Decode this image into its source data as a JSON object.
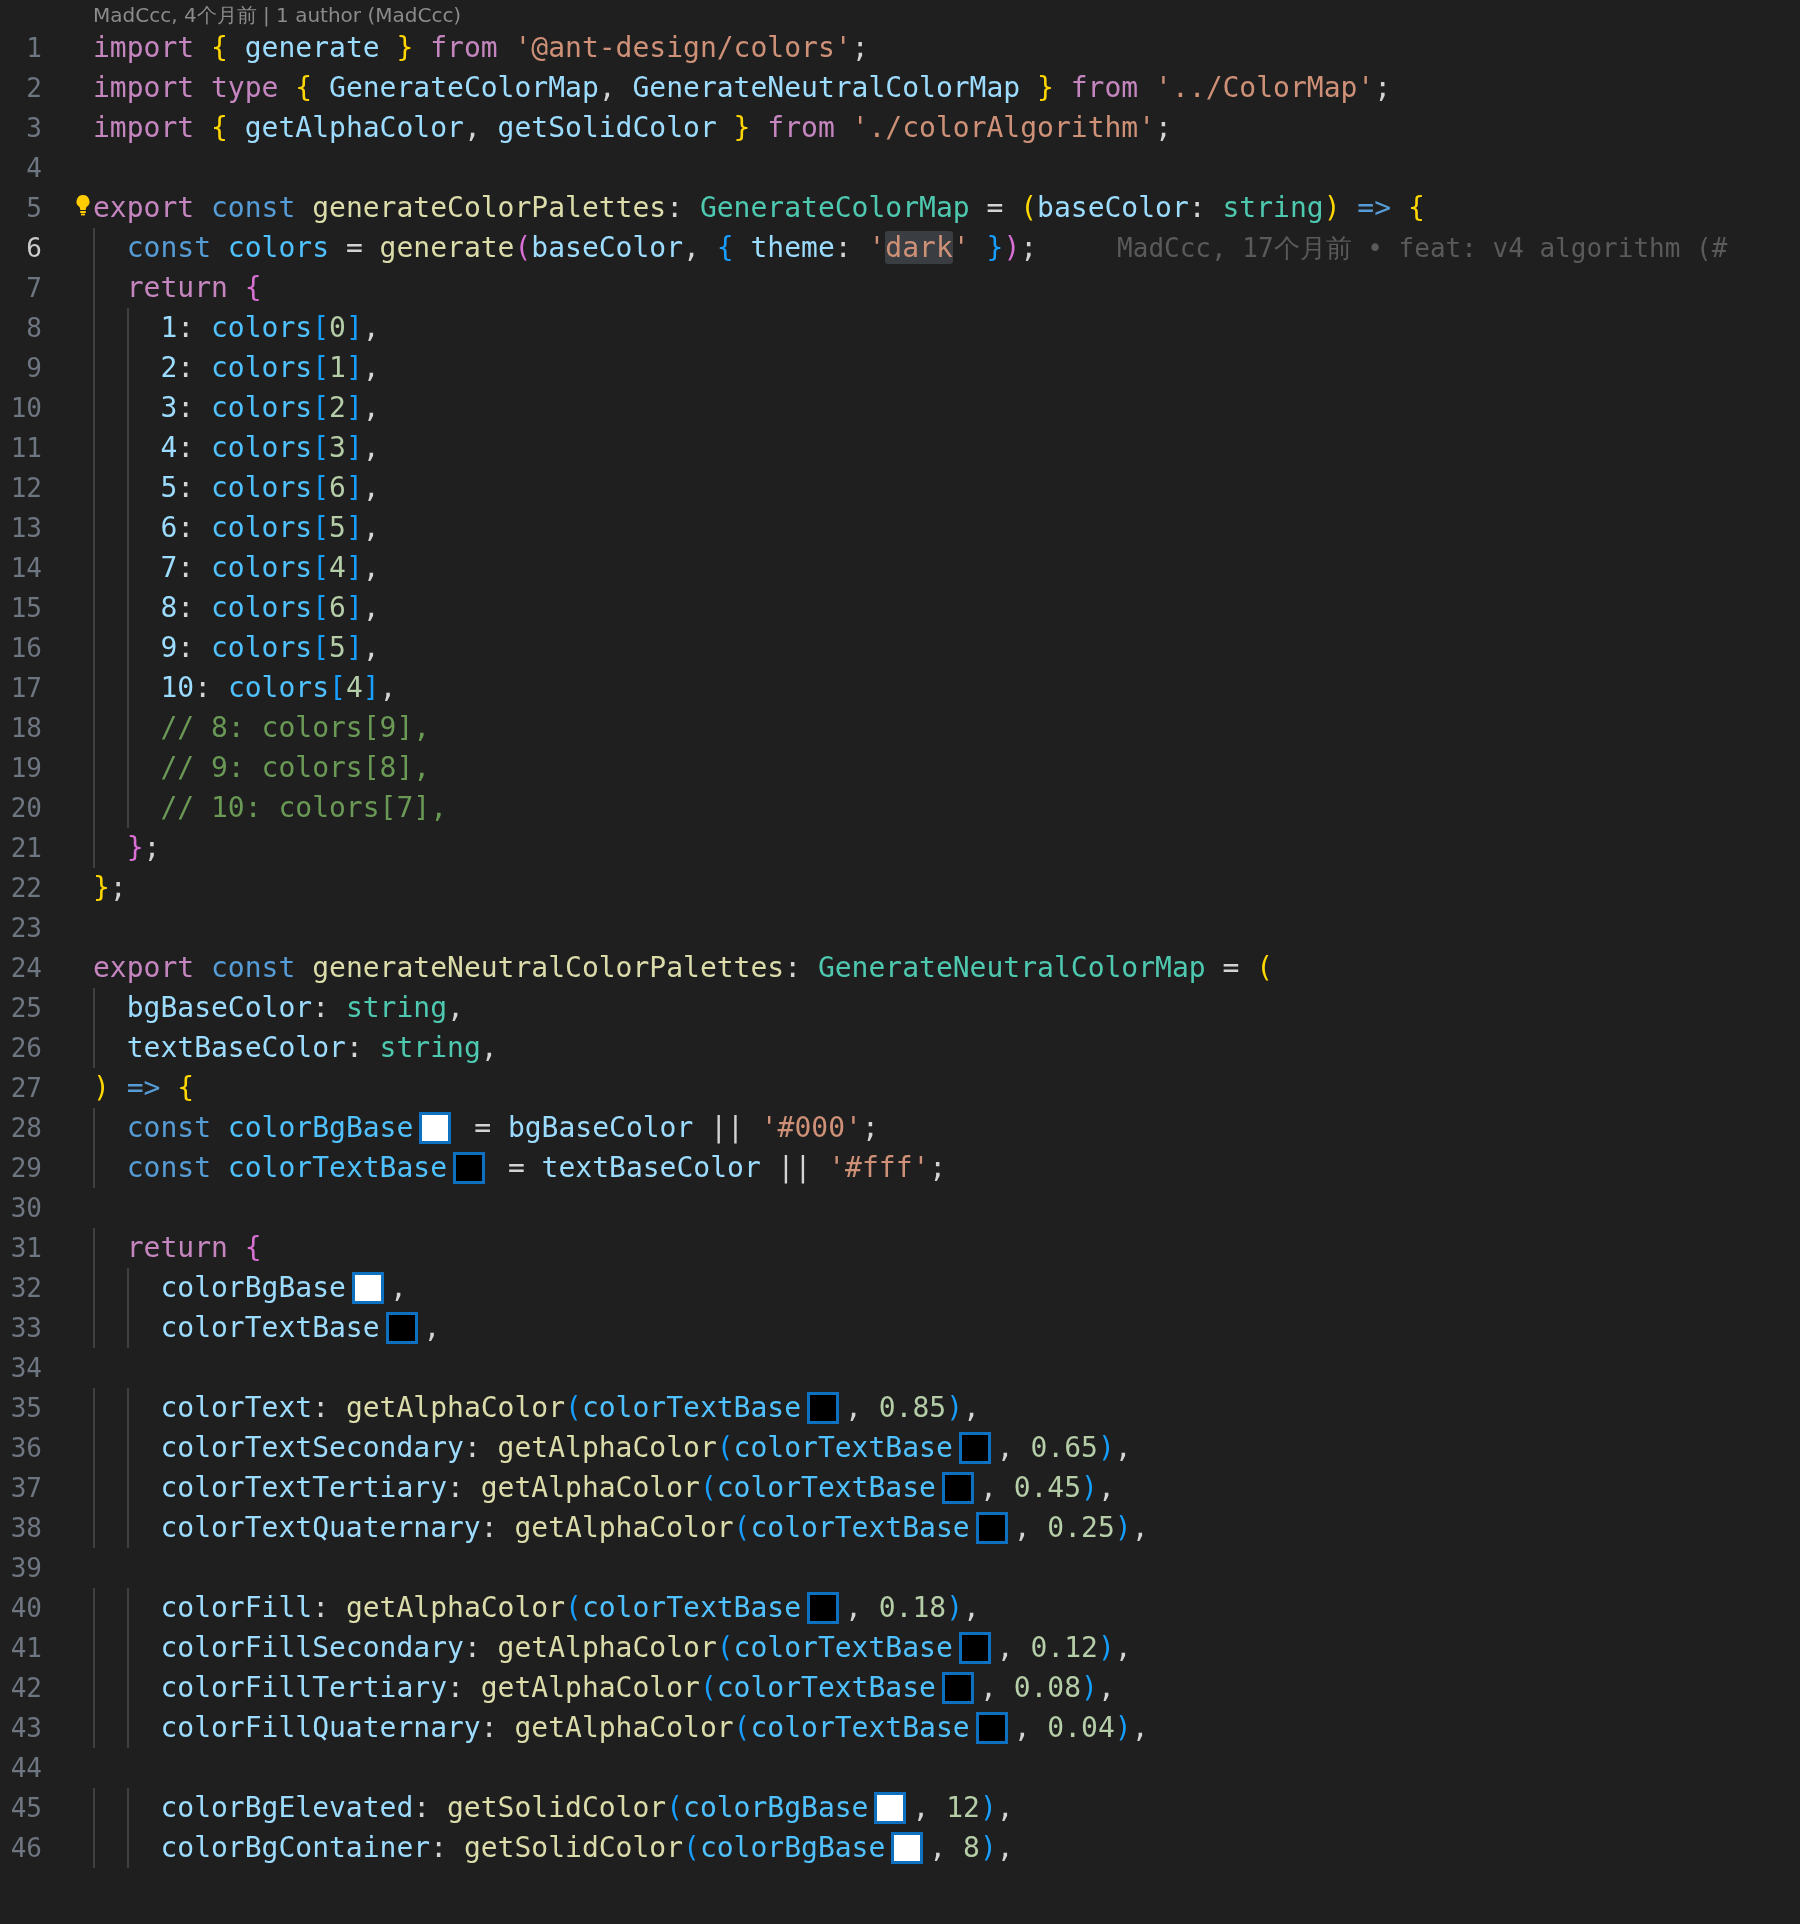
{
  "codelens": "MadCcc, 4个月前 | 1 author (MadCcc)",
  "lines": [
    {
      "number": "1",
      "current": false,
      "lightbulb": false,
      "tokens": [
        {
          "kind": "keyword",
          "text": "import"
        },
        {
          "kind": "bracket1",
          "text": " {"
        },
        {
          "kind": "variable",
          "text": " generate"
        },
        {
          "kind": "bracket1",
          "text": " }"
        },
        {
          "kind": "keyword",
          "text": " from"
        },
        {
          "kind": "string",
          "text": " '@ant-design/colors'"
        },
        {
          "kind": "punct",
          "text": ";"
        }
      ]
    },
    {
      "number": "2",
      "current": false,
      "lightbulb": false,
      "tokens": [
        {
          "kind": "keyword",
          "text": "import"
        },
        {
          "kind": "keyword",
          "text": " type"
        },
        {
          "kind": "bracket1",
          "text": " {"
        },
        {
          "kind": "variable",
          "text": " GenerateColorMap"
        },
        {
          "kind": "punct",
          "text": ","
        },
        {
          "kind": "variable",
          "text": " GenerateNeutralColorMap"
        },
        {
          "kind": "bracket1",
          "text": " }"
        },
        {
          "kind": "keyword",
          "text": " from"
        },
        {
          "kind": "string",
          "text": " '../ColorMap'"
        },
        {
          "kind": "punct",
          "text": ";"
        }
      ]
    },
    {
      "number": "3",
      "current": false,
      "lightbulb": false,
      "tokens": [
        {
          "kind": "keyword",
          "text": "import"
        },
        {
          "kind": "bracket1",
          "text": " {"
        },
        {
          "kind": "variable",
          "text": " getAlphaColor"
        },
        {
          "kind": "punct",
          "text": ","
        },
        {
          "kind": "variable",
          "text": " getSolidColor"
        },
        {
          "kind": "bracket1",
          "text": " }"
        },
        {
          "kind": "keyword",
          "text": " from"
        },
        {
          "kind": "string",
          "text": " './colorAlgorithm'"
        },
        {
          "kind": "punct",
          "text": ";"
        }
      ]
    },
    {
      "number": "4",
      "current": false,
      "lightbulb": false
    },
    {
      "number": "5",
      "current": false,
      "lightbulb": true,
      "tokens": [
        {
          "kind": "keyword",
          "text": "export"
        },
        {
          "kind": "storage",
          "text": " const"
        },
        {
          "kind": "function",
          "text": " generateColorPalettes"
        },
        {
          "kind": "punct",
          "text": ": "
        },
        {
          "kind": "type",
          "text": "GenerateColorMap"
        },
        {
          "kind": "punct",
          "text": " = "
        },
        {
          "kind": "bracket1",
          "text": "("
        },
        {
          "kind": "variable",
          "text": "baseColor"
        },
        {
          "kind": "punct",
          "text": ": "
        },
        {
          "kind": "type",
          "text": "string"
        },
        {
          "kind": "bracket1",
          "text": ")"
        },
        {
          "kind": "storage",
          "text": " =>"
        },
        {
          "kind": "bracket1",
          "text": " {"
        }
      ]
    },
    {
      "number": "6",
      "current": true,
      "lightbulb": false,
      "blame": "MadCcc, 17个月前 • feat: v4 algorithm (#",
      "tokens": [
        {
          "kind": "storage",
          "text": "  const"
        },
        {
          "kind": "constant",
          "text": " colors"
        },
        {
          "kind": "punct",
          "text": " = "
        },
        {
          "kind": "function",
          "text": "generate"
        },
        {
          "kind": "bracket2",
          "text": "("
        },
        {
          "kind": "variable",
          "text": "baseColor"
        },
        {
          "kind": "punct",
          "text": ", "
        },
        {
          "kind": "bracket3",
          "text": "{"
        },
        {
          "kind": "variable",
          "text": " theme"
        },
        {
          "kind": "punct",
          "text": ": "
        },
        {
          "kind": "string",
          "text": "'"
        },
        {
          "kind": "match",
          "text": "dark"
        },
        {
          "kind": "string",
          "text": "'"
        },
        {
          "kind": "bracket3",
          "text": " }"
        },
        {
          "kind": "bracket2",
          "text": ")"
        },
        {
          "kind": "punct",
          "text": ";"
        }
      ]
    },
    {
      "number": "7",
      "current": false,
      "lightbulb": false,
      "tokens": [
        {
          "kind": "keyword",
          "text": "  return"
        },
        {
          "kind": "bracket2",
          "text": " {"
        }
      ]
    },
    {
      "number": "8",
      "current": false,
      "lightbulb": false,
      "tokens": [
        {
          "kind": "variable",
          "text": "    1"
        },
        {
          "kind": "punct",
          "text": ": "
        },
        {
          "kind": "constant",
          "text": "colors"
        },
        {
          "kind": "bracket3",
          "text": "["
        },
        {
          "kind": "number",
          "text": "0"
        },
        {
          "kind": "bracket3",
          "text": "]"
        },
        {
          "kind": "punct",
          "text": ","
        }
      ]
    },
    {
      "number": "9",
      "current": false,
      "lightbulb": false,
      "tokens": [
        {
          "kind": "variable",
          "text": "    2"
        },
        {
          "kind": "punct",
          "text": ": "
        },
        {
          "kind": "constant",
          "text": "colors"
        },
        {
          "kind": "bracket3",
          "text": "["
        },
        {
          "kind": "number",
          "text": "1"
        },
        {
          "kind": "bracket3",
          "text": "]"
        },
        {
          "kind": "punct",
          "text": ","
        }
      ]
    },
    {
      "number": "10",
      "current": false,
      "lightbulb": false,
      "tokens": [
        {
          "kind": "variable",
          "text": "    3"
        },
        {
          "kind": "punct",
          "text": ": "
        },
        {
          "kind": "constant",
          "text": "colors"
        },
        {
          "kind": "bracket3",
          "text": "["
        },
        {
          "kind": "number",
          "text": "2"
        },
        {
          "kind": "bracket3",
          "text": "]"
        },
        {
          "kind": "punct",
          "text": ","
        }
      ]
    },
    {
      "number": "11",
      "current": false,
      "lightbulb": false,
      "tokens": [
        {
          "kind": "variable",
          "text": "    4"
        },
        {
          "kind": "punct",
          "text": ": "
        },
        {
          "kind": "constant",
          "text": "colors"
        },
        {
          "kind": "bracket3",
          "text": "["
        },
        {
          "kind": "number",
          "text": "3"
        },
        {
          "kind": "bracket3",
          "text": "]"
        },
        {
          "kind": "punct",
          "text": ","
        }
      ]
    },
    {
      "number": "12",
      "current": false,
      "lightbulb": false,
      "tokens": [
        {
          "kind": "variable",
          "text": "    5"
        },
        {
          "kind": "punct",
          "text": ": "
        },
        {
          "kind": "constant",
          "text": "colors"
        },
        {
          "kind": "bracket3",
          "text": "["
        },
        {
          "kind": "number",
          "text": "6"
        },
        {
          "kind": "bracket3",
          "text": "]"
        },
        {
          "kind": "punct",
          "text": ","
        }
      ]
    },
    {
      "number": "13",
      "current": false,
      "lightbulb": false,
      "tokens": [
        {
          "kind": "variable",
          "text": "    6"
        },
        {
          "kind": "punct",
          "text": ": "
        },
        {
          "kind": "constant",
          "text": "colors"
        },
        {
          "kind": "bracket3",
          "text": "["
        },
        {
          "kind": "number",
          "text": "5"
        },
        {
          "kind": "bracket3",
          "text": "]"
        },
        {
          "kind": "punct",
          "text": ","
        }
      ]
    },
    {
      "number": "14",
      "current": false,
      "lightbulb": false,
      "tokens": [
        {
          "kind": "variable",
          "text": "    7"
        },
        {
          "kind": "punct",
          "text": ": "
        },
        {
          "kind": "constant",
          "text": "colors"
        },
        {
          "kind": "bracket3",
          "text": "["
        },
        {
          "kind": "number",
          "text": "4"
        },
        {
          "kind": "bracket3",
          "text": "]"
        },
        {
          "kind": "punct",
          "text": ","
        }
      ]
    },
    {
      "number": "15",
      "current": false,
      "lightbulb": false,
      "tokens": [
        {
          "kind": "variable",
          "text": "    8"
        },
        {
          "kind": "punct",
          "text": ": "
        },
        {
          "kind": "constant",
          "text": "colors"
        },
        {
          "kind": "bracket3",
          "text": "["
        },
        {
          "kind": "number",
          "text": "6"
        },
        {
          "kind": "bracket3",
          "text": "]"
        },
        {
          "kind": "punct",
          "text": ","
        }
      ]
    },
    {
      "number": "16",
      "current": false,
      "lightbulb": false,
      "tokens": [
        {
          "kind": "variable",
          "text": "    9"
        },
        {
          "kind": "punct",
          "text": ": "
        },
        {
          "kind": "constant",
          "text": "colors"
        },
        {
          "kind": "bracket3",
          "text": "["
        },
        {
          "kind": "number",
          "text": "5"
        },
        {
          "kind": "bracket3",
          "text": "]"
        },
        {
          "kind": "punct",
          "text": ","
        }
      ]
    },
    {
      "number": "17",
      "current": false,
      "lightbulb": false,
      "tokens": [
        {
          "kind": "variable",
          "text": "    10"
        },
        {
          "kind": "punct",
          "text": ": "
        },
        {
          "kind": "constant",
          "text": "colors"
        },
        {
          "kind": "bracket3",
          "text": "["
        },
        {
          "kind": "number",
          "text": "4"
        },
        {
          "kind": "bracket3",
          "text": "]"
        },
        {
          "kind": "punct",
          "text": ","
        }
      ]
    },
    {
      "number": "18",
      "current": false,
      "lightbulb": false,
      "tokens": [
        {
          "kind": "comment",
          "text": "    // 8: colors[9],"
        }
      ]
    },
    {
      "number": "19",
      "current": false,
      "lightbulb": false,
      "tokens": [
        {
          "kind": "comment",
          "text": "    // 9: colors[8],"
        }
      ]
    },
    {
      "number": "20",
      "current": false,
      "lightbulb": false,
      "tokens": [
        {
          "kind": "comment",
          "text": "    // 10: colors[7],"
        }
      ]
    },
    {
      "number": "21",
      "current": false,
      "lightbulb": false,
      "tokens": [
        {
          "kind": "bracket2",
          "text": "  }"
        },
        {
          "kind": "punct",
          "text": ";"
        }
      ]
    },
    {
      "number": "22",
      "current": false,
      "lightbulb": false,
      "tokens": [
        {
          "kind": "bracket1",
          "text": "}"
        },
        {
          "kind": "punct",
          "text": ";"
        }
      ]
    },
    {
      "number": "23",
      "current": false,
      "lightbulb": false
    },
    {
      "number": "24",
      "current": false,
      "lightbulb": false,
      "tokens": [
        {
          "kind": "keyword",
          "text": "export"
        },
        {
          "kind": "storage",
          "text": " const"
        },
        {
          "kind": "function",
          "text": " generateNeutralColorPalettes"
        },
        {
          "kind": "punct",
          "text": ": "
        },
        {
          "kind": "type",
          "text": "GenerateNeutralColorMap"
        },
        {
          "kind": "punct",
          "text": " = "
        },
        {
          "kind": "bracket1",
          "text": "("
        }
      ]
    },
    {
      "number": "25",
      "current": false,
      "lightbulb": false,
      "tokens": [
        {
          "kind": "variable",
          "text": "  bgBaseColor"
        },
        {
          "kind": "punct",
          "text": ": "
        },
        {
          "kind": "type",
          "text": "string"
        },
        {
          "kind": "punct",
          "text": ","
        }
      ]
    },
    {
      "number": "26",
      "current": false,
      "lightbulb": false,
      "tokens": [
        {
          "kind": "variable",
          "text": "  textBaseColor"
        },
        {
          "kind": "punct",
          "text": ": "
        },
        {
          "kind": "type",
          "text": "string"
        },
        {
          "kind": "punct",
          "text": ","
        }
      ]
    },
    {
      "number": "27",
      "current": false,
      "lightbulb": false,
      "tokens": [
        {
          "kind": "bracket1",
          "text": ")"
        },
        {
          "kind": "storage",
          "text": " =>"
        },
        {
          "kind": "bracket1",
          "text": " {"
        }
      ]
    },
    {
      "number": "28",
      "current": false,
      "lightbulb": false,
      "tokens": [
        {
          "kind": "storage",
          "text": "  const"
        },
        {
          "kind": "constant",
          "text": " colorBgBase"
        },
        {
          "kind": "swatch",
          "color": "#ffffff"
        },
        {
          "kind": "punct",
          "text": " = "
        },
        {
          "kind": "variable",
          "text": "bgBaseColor"
        },
        {
          "kind": "punct",
          "text": " || "
        },
        {
          "kind": "string",
          "text": "'#000'"
        },
        {
          "kind": "punct",
          "text": ";"
        }
      ]
    },
    {
      "number": "29",
      "current": false,
      "lightbulb": false,
      "tokens": [
        {
          "kind": "storage",
          "text": "  const"
        },
        {
          "kind": "constant",
          "text": " colorTextBase"
        },
        {
          "kind": "swatch",
          "color": "#000000"
        },
        {
          "kind": "punct",
          "text": " = "
        },
        {
          "kind": "variable",
          "text": "textBaseColor"
        },
        {
          "kind": "punct",
          "text": " || "
        },
        {
          "kind": "string",
          "text": "'#fff'"
        },
        {
          "kind": "punct",
          "text": ";"
        }
      ]
    },
    {
      "number": "30",
      "current": false,
      "lightbulb": false
    },
    {
      "number": "31",
      "current": false,
      "lightbulb": false,
      "tokens": [
        {
          "kind": "keyword",
          "text": "  return"
        },
        {
          "kind": "bracket2",
          "text": " {"
        }
      ]
    },
    {
      "number": "32",
      "current": false,
      "lightbulb": false,
      "tokens": [
        {
          "kind": "variable",
          "text": "    colorBgBase"
        },
        {
          "kind": "swatch",
          "color": "#ffffff"
        },
        {
          "kind": "punct",
          "text": ","
        }
      ]
    },
    {
      "number": "33",
      "current": false,
      "lightbulb": false,
      "tokens": [
        {
          "kind": "variable",
          "text": "    colorTextBase"
        },
        {
          "kind": "swatch",
          "color": "#000000"
        },
        {
          "kind": "punct",
          "text": ","
        }
      ]
    },
    {
      "number": "34",
      "current": false,
      "lightbulb": false
    },
    {
      "number": "35",
      "current": false,
      "lightbulb": false,
      "tokens": [
        {
          "kind": "variable",
          "text": "    colorText"
        },
        {
          "kind": "punct",
          "text": ": "
        },
        {
          "kind": "function",
          "text": "getAlphaColor"
        },
        {
          "kind": "bracket3",
          "text": "("
        },
        {
          "kind": "constant",
          "text": "colorTextBase"
        },
        {
          "kind": "swatch",
          "color": "#000000"
        },
        {
          "kind": "punct",
          "text": ", "
        },
        {
          "kind": "number",
          "text": "0.85"
        },
        {
          "kind": "bracket3",
          "text": ")"
        },
        {
          "kind": "punct",
          "text": ","
        }
      ]
    },
    {
      "number": "36",
      "current": false,
      "lightbulb": false,
      "tokens": [
        {
          "kind": "variable",
          "text": "    colorTextSecondary"
        },
        {
          "kind": "punct",
          "text": ": "
        },
        {
          "kind": "function",
          "text": "getAlphaColor"
        },
        {
          "kind": "bracket3",
          "text": "("
        },
        {
          "kind": "constant",
          "text": "colorTextBase"
        },
        {
          "kind": "swatch",
          "color": "#000000"
        },
        {
          "kind": "punct",
          "text": ", "
        },
        {
          "kind": "number",
          "text": "0.65"
        },
        {
          "kind": "bracket3",
          "text": ")"
        },
        {
          "kind": "punct",
          "text": ","
        }
      ]
    },
    {
      "number": "37",
      "current": false,
      "lightbulb": false,
      "tokens": [
        {
          "kind": "variable",
          "text": "    colorTextTertiary"
        },
        {
          "kind": "punct",
          "text": ": "
        },
        {
          "kind": "function",
          "text": "getAlphaColor"
        },
        {
          "kind": "bracket3",
          "text": "("
        },
        {
          "kind": "constant",
          "text": "colorTextBase"
        },
        {
          "kind": "swatch",
          "color": "#000000"
        },
        {
          "kind": "punct",
          "text": ", "
        },
        {
          "kind": "number",
          "text": "0.45"
        },
        {
          "kind": "bracket3",
          "text": ")"
        },
        {
          "kind": "punct",
          "text": ","
        }
      ]
    },
    {
      "number": "38",
      "current": false,
      "lightbulb": false,
      "tokens": [
        {
          "kind": "variable",
          "text": "    colorTextQuaternary"
        },
        {
          "kind": "punct",
          "text": ": "
        },
        {
          "kind": "function",
          "text": "getAlphaColor"
        },
        {
          "kind": "bracket3",
          "text": "("
        },
        {
          "kind": "constant",
          "text": "colorTextBase"
        },
        {
          "kind": "swatch",
          "color": "#000000"
        },
        {
          "kind": "punct",
          "text": ", "
        },
        {
          "kind": "number",
          "text": "0.25"
        },
        {
          "kind": "bracket3",
          "text": ")"
        },
        {
          "kind": "punct",
          "text": ","
        }
      ]
    },
    {
      "number": "39",
      "current": false,
      "lightbulb": false
    },
    {
      "number": "40",
      "current": false,
      "lightbulb": false,
      "tokens": [
        {
          "kind": "variable",
          "text": "    colorFill"
        },
        {
          "kind": "punct",
          "text": ": "
        },
        {
          "kind": "function",
          "text": "getAlphaColor"
        },
        {
          "kind": "bracket3",
          "text": "("
        },
        {
          "kind": "constant",
          "text": "colorTextBase"
        },
        {
          "kind": "swatch",
          "color": "#000000"
        },
        {
          "kind": "punct",
          "text": ", "
        },
        {
          "kind": "number",
          "text": "0.18"
        },
        {
          "kind": "bracket3",
          "text": ")"
        },
        {
          "kind": "punct",
          "text": ","
        }
      ]
    },
    {
      "number": "41",
      "current": false,
      "lightbulb": false,
      "tokens": [
        {
          "kind": "variable",
          "text": "    colorFillSecondary"
        },
        {
          "kind": "punct",
          "text": ": "
        },
        {
          "kind": "function",
          "text": "getAlphaColor"
        },
        {
          "kind": "bracket3",
          "text": "("
        },
        {
          "kind": "constant",
          "text": "colorTextBase"
        },
        {
          "kind": "swatch",
          "color": "#000000"
        },
        {
          "kind": "punct",
          "text": ", "
        },
        {
          "kind": "number",
          "text": "0.12"
        },
        {
          "kind": "bracket3",
          "text": ")"
        },
        {
          "kind": "punct",
          "text": ","
        }
      ]
    },
    {
      "number": "42",
      "current": false,
      "lightbulb": false,
      "tokens": [
        {
          "kind": "variable",
          "text": "    colorFillTertiary"
        },
        {
          "kind": "punct",
          "text": ": "
        },
        {
          "kind": "function",
          "text": "getAlphaColor"
        },
        {
          "kind": "bracket3",
          "text": "("
        },
        {
          "kind": "constant",
          "text": "colorTextBase"
        },
        {
          "kind": "swatch",
          "color": "#000000"
        },
        {
          "kind": "punct",
          "text": ", "
        },
        {
          "kind": "number",
          "text": "0.08"
        },
        {
          "kind": "bracket3",
          "text": ")"
        },
        {
          "kind": "punct",
          "text": ","
        }
      ]
    },
    {
      "number": "43",
      "current": false,
      "lightbulb": false,
      "tokens": [
        {
          "kind": "variable",
          "text": "    colorFillQuaternary"
        },
        {
          "kind": "punct",
          "text": ": "
        },
        {
          "kind": "function",
          "text": "getAlphaColor"
        },
        {
          "kind": "bracket3",
          "text": "("
        },
        {
          "kind": "constant",
          "text": "colorTextBase"
        },
        {
          "kind": "swatch",
          "color": "#000000"
        },
        {
          "kind": "punct",
          "text": ", "
        },
        {
          "kind": "number",
          "text": "0.04"
        },
        {
          "kind": "bracket3",
          "text": ")"
        },
        {
          "kind": "punct",
          "text": ","
        }
      ]
    },
    {
      "number": "44",
      "current": false,
      "lightbulb": false
    },
    {
      "number": "45",
      "current": false,
      "lightbulb": false,
      "tokens": [
        {
          "kind": "variable",
          "text": "    colorBgElevated"
        },
        {
          "kind": "punct",
          "text": ": "
        },
        {
          "kind": "function",
          "text": "getSolidColor"
        },
        {
          "kind": "bracket3",
          "text": "("
        },
        {
          "kind": "constant",
          "text": "colorBgBase"
        },
        {
          "kind": "swatch",
          "color": "#ffffff"
        },
        {
          "kind": "punct",
          "text": ", "
        },
        {
          "kind": "number",
          "text": "12"
        },
        {
          "kind": "bracket3",
          "text": ")"
        },
        {
          "kind": "punct",
          "text": ","
        }
      ]
    },
    {
      "number": "46",
      "current": false,
      "lightbulb": false,
      "tokens": [
        {
          "kind": "variable",
          "text": "    colorBgContainer"
        },
        {
          "kind": "punct",
          "text": ": "
        },
        {
          "kind": "function",
          "text": "getSolidColor"
        },
        {
          "kind": "bracket3",
          "text": "("
        },
        {
          "kind": "constant",
          "text": "colorBgBase"
        },
        {
          "kind": "swatch",
          "color": "#ffffff"
        },
        {
          "kind": "punct",
          "text": ", "
        },
        {
          "kind": "number",
          "text": "8"
        },
        {
          "kind": "bracket3",
          "text": ")"
        },
        {
          "kind": "punct",
          "text": ","
        }
      ]
    }
  ]
}
